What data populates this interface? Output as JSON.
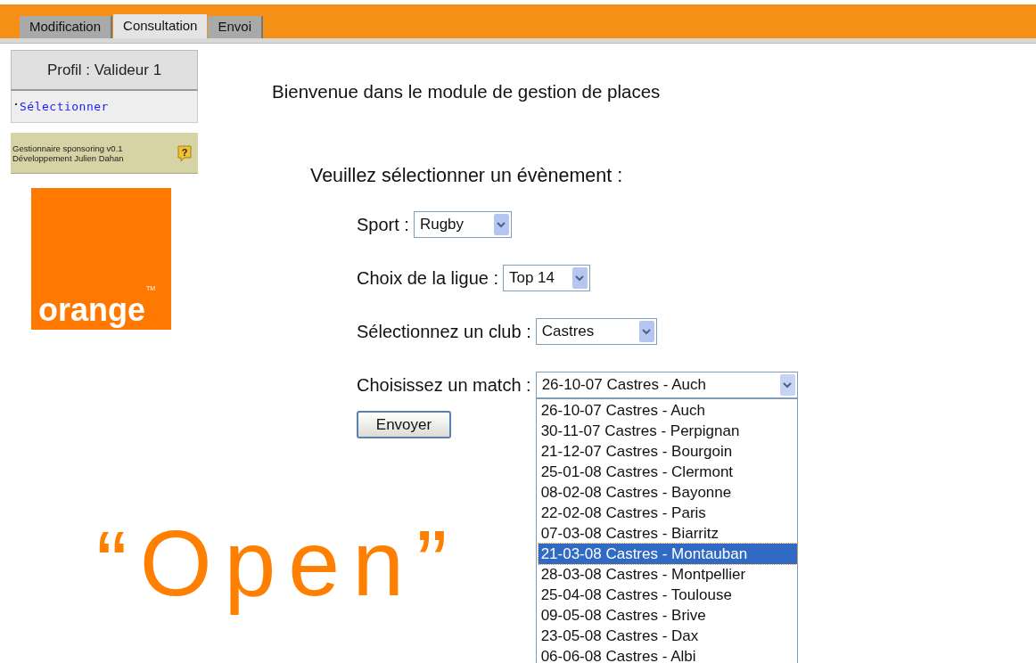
{
  "tabs": [
    {
      "label": "Modification",
      "selected": false
    },
    {
      "label": "Consultation",
      "selected": true
    },
    {
      "label": "Envoi",
      "selected": false
    }
  ],
  "sidebar": {
    "profile": "Profil : Valideur 1",
    "links": [
      "Sélectionner"
    ],
    "info": [
      "Gestionnaire sponsoring v0.1",
      "Développement Julien Dahan"
    ],
    "help": "?",
    "logo": "orange",
    "logo_mark": "TM"
  },
  "title": "Bienvenue dans le module de gestion de places",
  "subtitle": "Veuillez sélectionner un évènement :",
  "fields": [
    {
      "label": "Sport :",
      "value": "Rugby"
    },
    {
      "label": "Choix de la ligue :",
      "value": "Top 14"
    },
    {
      "label": "Sélectionnez un club :",
      "value": "Castres"
    },
    {
      "label": "Choisissez un match :",
      "value": "26-10-07 Castres - Auch",
      "expanded": true
    }
  ],
  "button": "Envoyer",
  "options": [
    {
      "label": "26-10-07 Castres - Auch",
      "selected": false
    },
    {
      "label": "30-11-07 Castres - Perpignan",
      "selected": false
    },
    {
      "label": "21-12-07 Castres - Bourgoin",
      "selected": false
    },
    {
      "label": "25-01-08 Castres - Clermont",
      "selected": false
    },
    {
      "label": "08-02-08 Castres - Bayonne",
      "selected": false
    },
    {
      "label": "22-02-08 Castres - Paris",
      "selected": false
    },
    {
      "label": "07-03-08 Castres - Biarritz",
      "selected": false
    },
    {
      "label": "21-03-08 Castres - Montauban",
      "selected": true
    },
    {
      "label": "28-03-08 Castres - Montpellier",
      "selected": false
    },
    {
      "label": "25-04-08 Castres - Toulouse",
      "selected": false
    },
    {
      "label": "09-05-08 Castres - Brive",
      "selected": false
    },
    {
      "label": "23-05-08 Castres - Dax",
      "selected": false
    },
    {
      "label": "06-06-08 Castres - Albi",
      "selected": false
    }
  ],
  "caption": "“Open”"
}
